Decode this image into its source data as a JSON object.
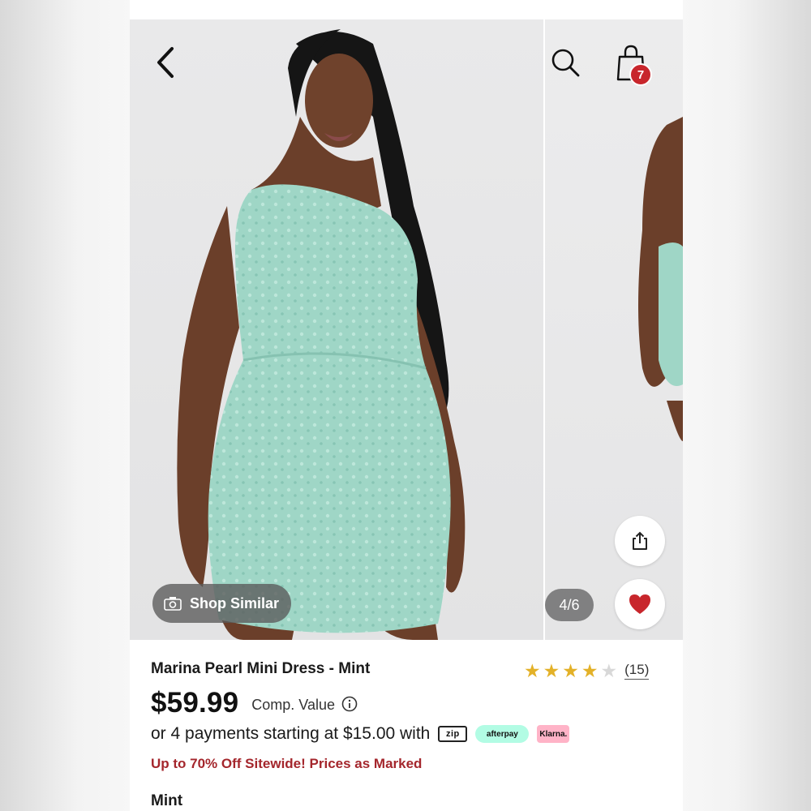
{
  "gallery": {
    "pager": "4/6",
    "shop_similar_label": "Shop Similar",
    "cart_count": "7"
  },
  "product": {
    "title": "Marina Pearl Mini Dress - Mint",
    "rating": {
      "stars_filled": 4,
      "stars_total": 5,
      "review_count": "(15)"
    },
    "price": "$59.99",
    "comp_value_label": "Comp. Value",
    "installments_text": "or 4 payments starting at $15.00 with",
    "payment_logos": {
      "zip": "zip",
      "afterpay": "afterpay",
      "klarna": "Klarna."
    },
    "promo": "Up to 70% Off Sitewide! Prices as Marked",
    "color_label": "Mint"
  },
  "colors": {
    "dress": "#9fd6c6",
    "badge": "#c8262c",
    "favorite": "#c8262c",
    "promo": "#a4262c",
    "star": "#e3b128"
  },
  "icons": [
    "chevron-left-icon",
    "search-icon",
    "shopping-bag-icon",
    "camera-icon",
    "share-icon",
    "heart-icon",
    "info-icon",
    "star-icon"
  ]
}
